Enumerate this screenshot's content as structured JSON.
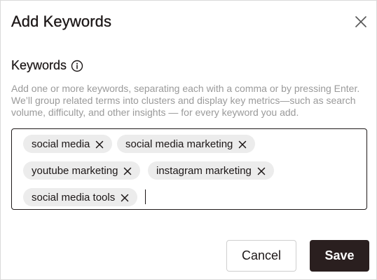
{
  "dialog": {
    "title": "Add Keywords",
    "close_icon": "close-icon"
  },
  "field": {
    "label": "Keywords",
    "info_icon": "info-icon",
    "help_text": "Add one or more keywords, separating each with a comma or by pressing Enter. We’ll group related terms into clusters and display key metrics—such as search volume, difficulty, and other insights — for every keyword you add."
  },
  "tags": [
    {
      "label": "social media"
    },
    {
      "label": "social media marketing"
    },
    {
      "label": "youtube marketing"
    },
    {
      "label": "instagram marketing"
    },
    {
      "label": "social media tools"
    }
  ],
  "input": {
    "value": ""
  },
  "actions": {
    "cancel_label": "Cancel",
    "save_label": "Save"
  },
  "colors": {
    "primary_button": "#2a1f1f",
    "chip_background": "#ececec",
    "help_text": "#9a9a9a"
  }
}
